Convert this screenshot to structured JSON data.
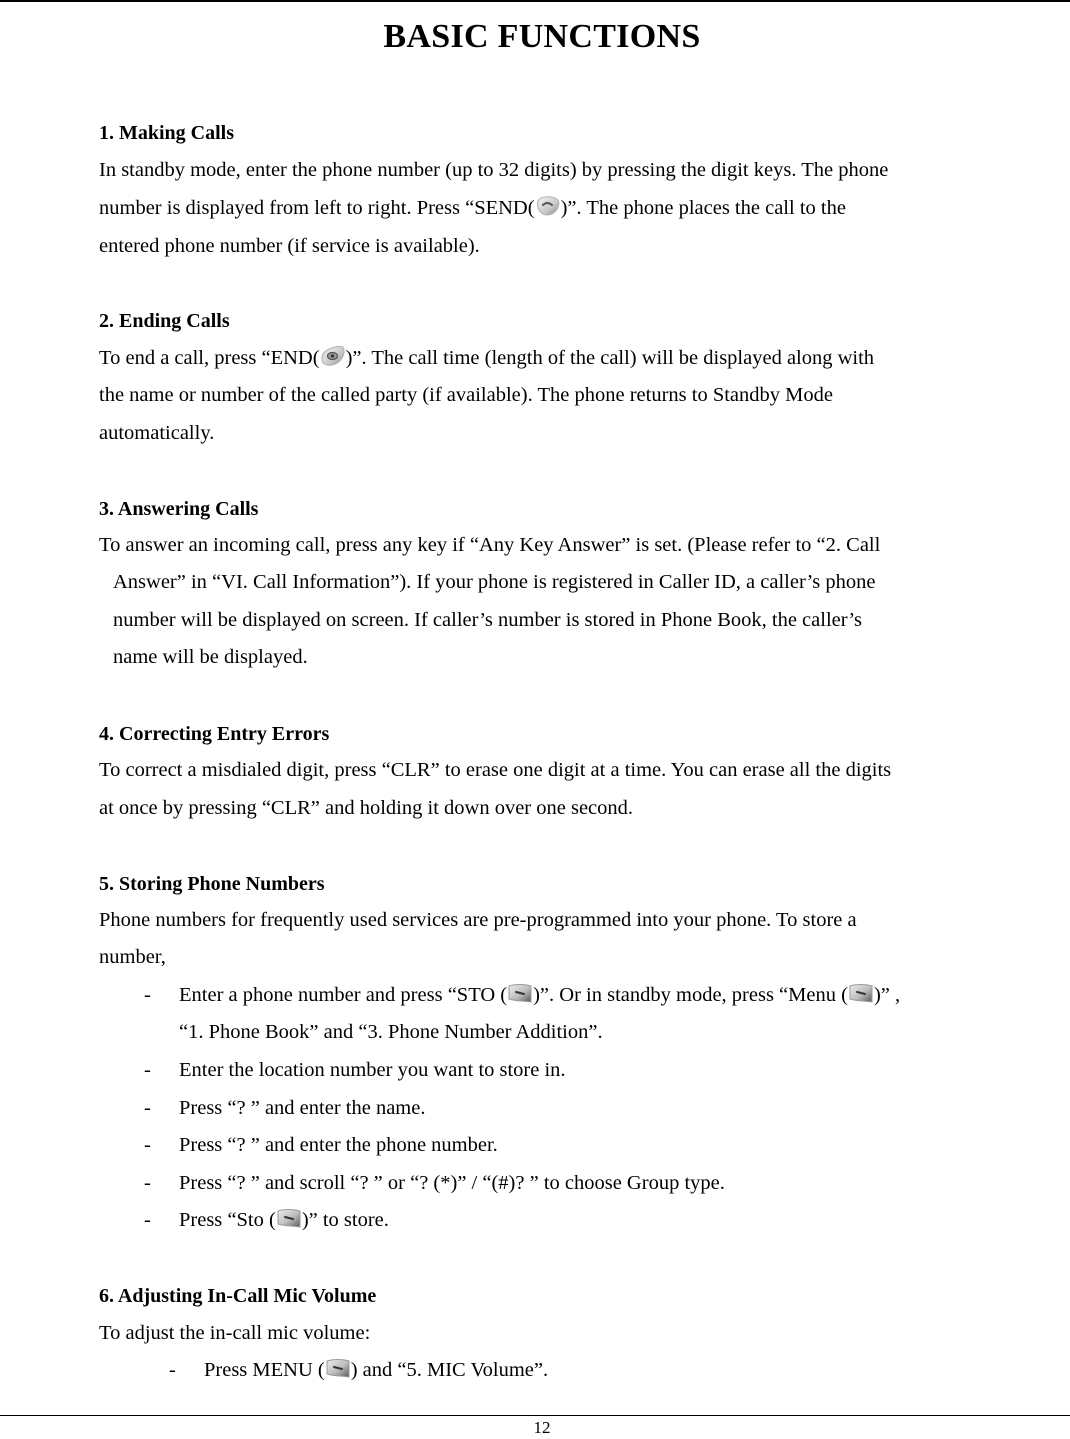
{
  "page": {
    "title": "BASIC FUNCTIONS",
    "page_number": "12"
  },
  "icons": {
    "send": "send-key-icon",
    "end": "end-key-icon",
    "soft": "soft-key-icon"
  },
  "sections": [
    {
      "heading": "1. Making Calls",
      "lines": [
        "In standby mode, enter the phone number (up to 32 digits) by pressing the digit keys. The phone",
        {
          "before": "number is displayed from left to right. Press “SEND(",
          "after": ")”. The phone places the call to the"
        },
        "entered phone number (if service is available)."
      ]
    },
    {
      "heading": "2. Ending Calls",
      "lines": [
        {
          "before": "To end a call, press “END(",
          "after": ")”. The call time (length of the call) will be displayed along with"
        },
        "the name or number of the called party (if available). The phone returns to Standby Mode",
        "automatically."
      ]
    },
    {
      "heading": "3. Answering Calls",
      "lines": [
        "To answer an incoming call, press any key if “Any Key Answer” is set. (Please refer to “2. Call",
        "Answer” in “VI. Call Information”). If your phone is registered in Caller ID, a caller’s phone",
        "number will be displayed on screen. If caller’s number is stored in Phone Book, the caller’s",
        "name will be displayed."
      ]
    },
    {
      "heading": "4. Correcting Entry Errors",
      "lines": [
        "To correct a misdialed digit, press “CLR” to erase one digit at a time. You can erase all the digits",
        "at once by pressing “CLR” and holding it down over one second."
      ]
    },
    {
      "heading": "5. Storing Phone Numbers",
      "lines": [
        "Phone numbers for frequently used services are pre-programmed into your phone. To store a",
        "number,"
      ],
      "bullets": [
        {
          "a": "Enter a phone number and press “STO (",
          "b": ")”. Or in standby mode, press “Menu (",
          "c": ")” ,",
          "cont": "“1. Phone Book” and “3. Phone Number Addition”."
        },
        {
          "text": "Enter the location number you want to store in."
        },
        {
          "text": "Press “?  ” and enter the name."
        },
        {
          "text": "Press “?  ” and enter the phone number."
        },
        {
          "text": "Press “?  ” and scroll “?  ” or “?  (*)” / “(#)?  ” to choose Group type."
        },
        {
          "a": "Press “Sto (",
          "b": ")” to store."
        }
      ]
    },
    {
      "heading": "6. Adjusting In-Call Mic Volume",
      "lines": [
        "To adjust the in-call mic volume:"
      ],
      "bullets": [
        {
          "a": "Press MENU (",
          "b": ") and “5. MIC Volume”."
        }
      ]
    }
  ],
  "bullet_marker": "-"
}
